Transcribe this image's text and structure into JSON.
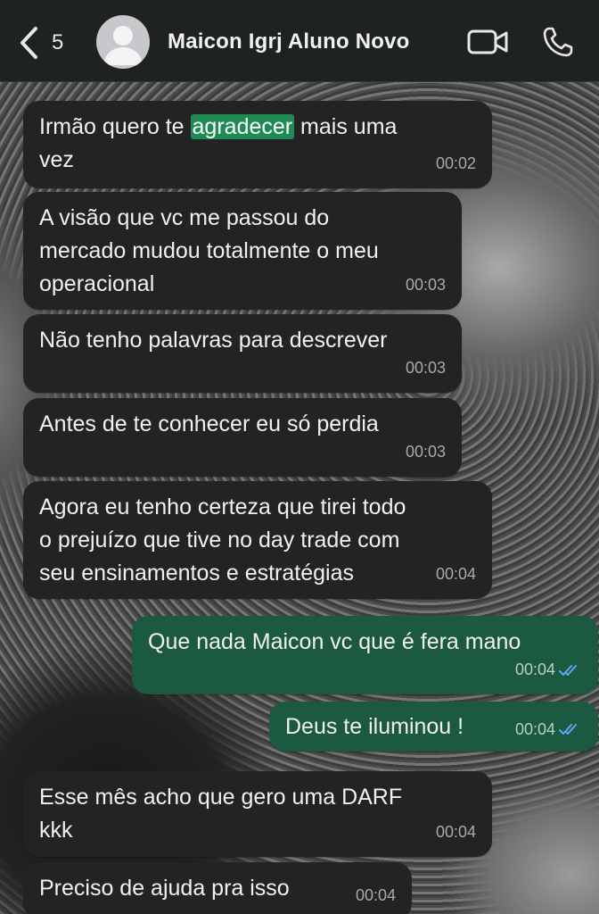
{
  "header": {
    "back_count": "5",
    "contact_name": "Maicon Igrj Aluno Novo"
  },
  "colors": {
    "incoming_bubble": "#222322",
    "outgoing_bubble": "#1b5a40",
    "highlight": "#1f8a54",
    "read_ticks": "#5aa8f0"
  },
  "messages": [
    {
      "direction": "in",
      "text_before": "Irmão quero te ",
      "highlight": "agradecer",
      "text_after": " mais uma\nvez",
      "time": "00:02"
    },
    {
      "direction": "in",
      "text": "A visão que vc me passou do\nmercado mudou totalmente o meu\noperacional",
      "time": "00:03"
    },
    {
      "direction": "in",
      "text": "Não tenho palavras para descrever",
      "time": "00:03"
    },
    {
      "direction": "in",
      "text": "Antes de te conhecer eu só perdia",
      "time": "00:03"
    },
    {
      "direction": "in",
      "text": "Agora eu tenho certeza que tirei todo\no prejuízo que tive no day trade com\nseu ensinamentos e estratégias",
      "time": "00:04"
    },
    {
      "direction": "out",
      "text": "Que nada Maicon vc que é fera mano",
      "time": "00:04",
      "status": "read"
    },
    {
      "direction": "out",
      "text": "Deus te iluminou !",
      "time": "00:04",
      "status": "read"
    },
    {
      "direction": "in",
      "text": "Esse mês acho que gero uma DARF\nkkk",
      "time": "00:04"
    },
    {
      "direction": "in",
      "text": "Preciso de ajuda pra isso",
      "time": "00:04"
    }
  ]
}
